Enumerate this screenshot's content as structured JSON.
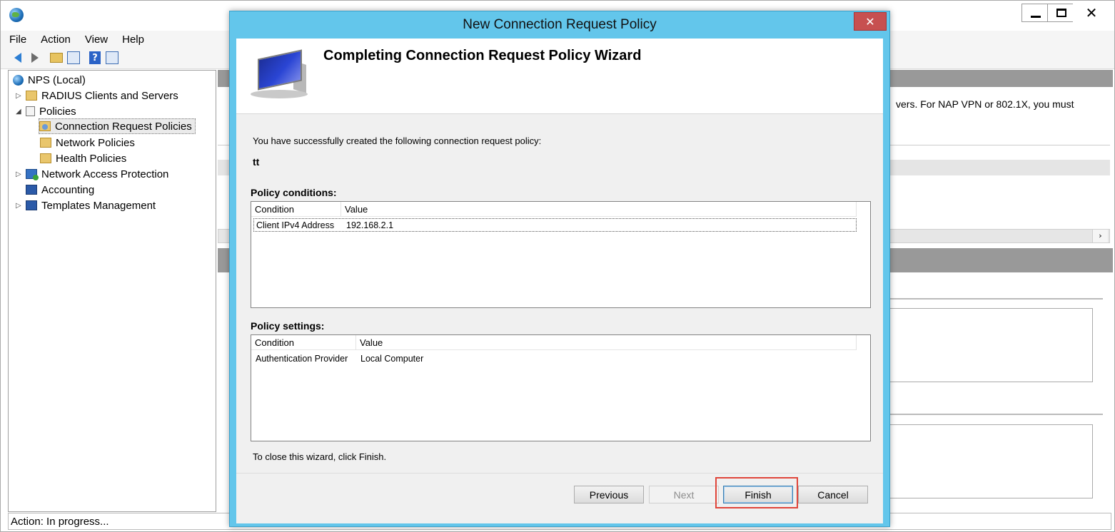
{
  "main_window": {
    "window_controls": {
      "close": "✕"
    },
    "menu": [
      "File",
      "Action",
      "View",
      "Help"
    ],
    "toolbar_icons": [
      "back-icon",
      "forward-icon",
      "up-folder-icon",
      "show-tree-icon",
      "help-icon",
      "properties-icon"
    ],
    "tree": [
      {
        "label": "NPS (Local)",
        "icon": "globe-icon",
        "expander": ""
      },
      {
        "label": "RADIUS Clients and Servers",
        "icon": "folder-icon",
        "expander": "▷"
      },
      {
        "label": "Policies",
        "icon": "document-icon",
        "expander": "◢"
      },
      {
        "label": "Connection Request Policies",
        "icon": "connection-policy-icon",
        "expander": ""
      },
      {
        "label": "Network Policies",
        "icon": "folder-icon",
        "expander": ""
      },
      {
        "label": "Health Policies",
        "icon": "folder-icon",
        "expander": ""
      },
      {
        "label": "Network Access Protection",
        "icon": "shield-icon",
        "expander": "▷"
      },
      {
        "label": "Accounting",
        "icon": "monitor-icon",
        "expander": ""
      },
      {
        "label": "Templates Management",
        "icon": "monitor-icon",
        "expander": "▷"
      }
    ],
    "right_pane_text": "vers. For NAP VPN or 802.1X, you must",
    "status": "Action:  In progress..."
  },
  "dialog": {
    "title": "New Connection Request Policy",
    "close_glyph": "✕",
    "heading": "Completing Connection Request Policy Wizard",
    "success_text": "You have successfully created the following connection request policy:",
    "policy_name": "tt",
    "conditions": {
      "label": "Policy conditions:",
      "columns": [
        "Condition",
        "Value"
      ],
      "rows": [
        {
          "condition": "Client IPv4 Address",
          "value": "192.168.2.1"
        }
      ]
    },
    "settings": {
      "label": "Policy settings:",
      "columns": [
        "Condition",
        "Value"
      ],
      "rows": [
        {
          "condition": "Authentication Provider",
          "value": "Local Computer"
        }
      ]
    },
    "close_hint": "To close this wizard, click Finish.",
    "buttons": {
      "previous": "Previous",
      "next": "Next",
      "finish": "Finish",
      "cancel": "Cancel"
    }
  }
}
